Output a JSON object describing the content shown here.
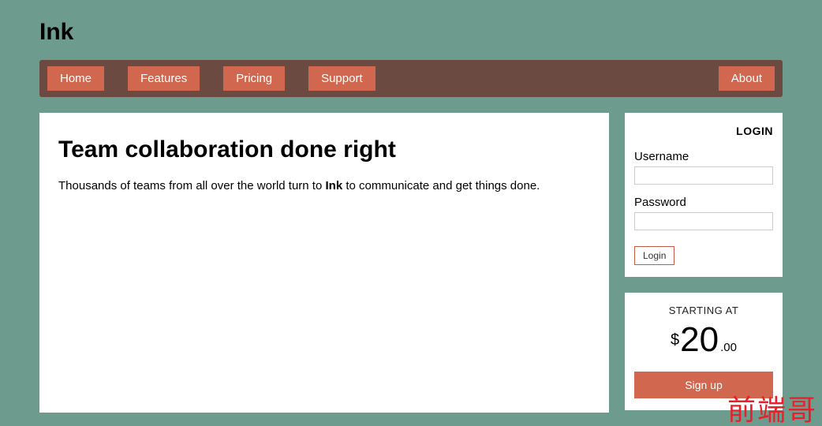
{
  "brand": "Ink",
  "nav": {
    "left": [
      "Home",
      "Features",
      "Pricing",
      "Support"
    ],
    "right": "About"
  },
  "main": {
    "heading": "Team collaboration done right",
    "para_prefix": "Thousands of teams from all over the world turn to ",
    "para_bold": "Ink",
    "para_suffix": " to communicate and get things done."
  },
  "login": {
    "title": "LOGIN",
    "username_label": "Username",
    "password_label": "Password",
    "submit": "Login"
  },
  "pricing": {
    "starting": "STARTING AT",
    "currency": "$",
    "amount": "20",
    "cents": ".00",
    "signup": "Sign up"
  },
  "watermark": "前端哥"
}
